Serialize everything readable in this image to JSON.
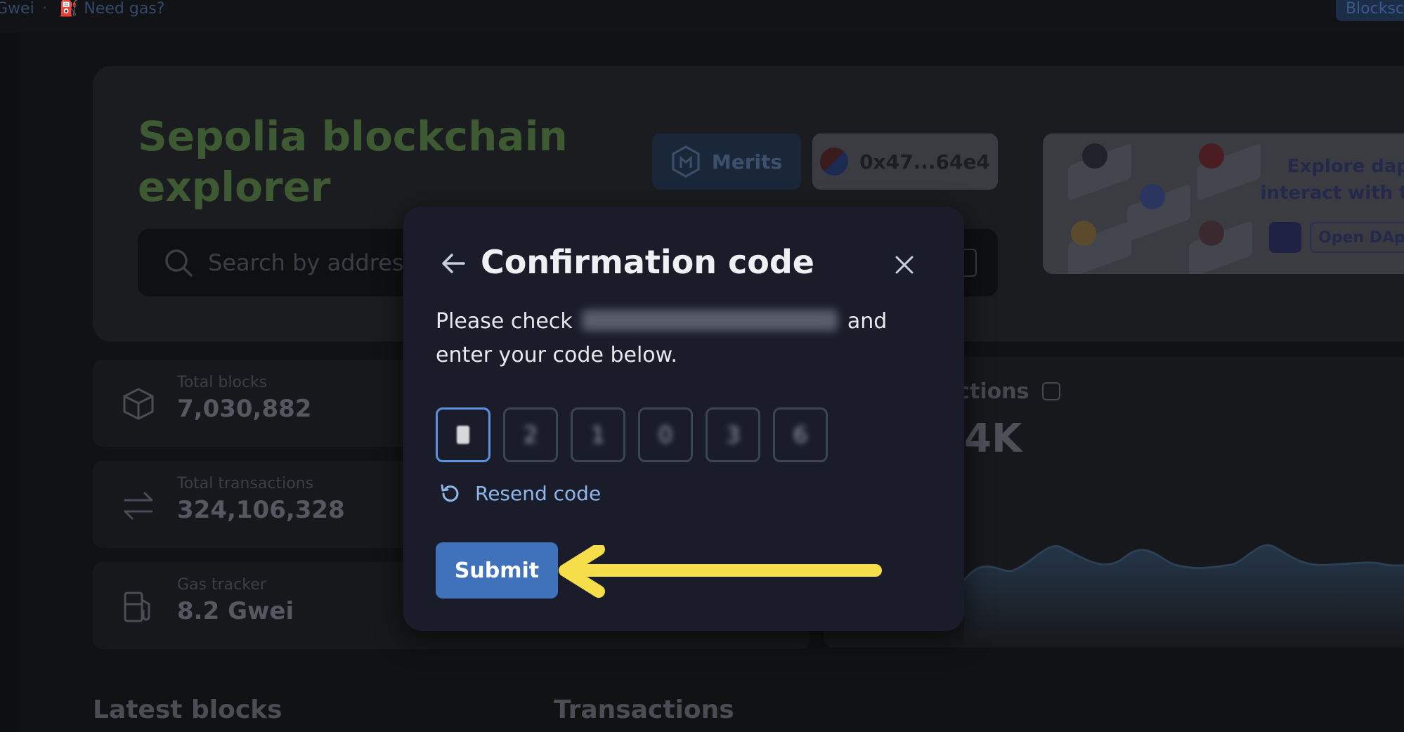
{
  "topbar": {
    "gas_unit": "Gwei",
    "separator": "·",
    "need_gas_label": "Need gas?",
    "blockscout_label": "Blocksc"
  },
  "hero": {
    "title": "Sepolia blockchain explorer",
    "search_placeholder": "Search by address",
    "merits_label": "Merits",
    "wallet_address": "0x47...64e4",
    "ad_text": "Explore dapps interact with tho",
    "ad_button": "Open DApp"
  },
  "stats": [
    {
      "label": "Total blocks",
      "value": "7,030,882",
      "icon": "cube-icon"
    },
    {
      "label": "Total transactions",
      "value": "324,106,328",
      "icon": "arrows-exchange-icon"
    },
    {
      "label": "Gas tracker",
      "value": "8.2 Gwei",
      "icon": "gas-pump-icon"
    }
  ],
  "tx_panel": {
    "label": "actions",
    "value": "4K"
  },
  "sections": {
    "latest_blocks": "Latest blocks",
    "transactions": "Transactions"
  },
  "modal": {
    "title": "Confirmation code",
    "instruction_prefix": "Please check",
    "instruction_suffix": "and enter your code below.",
    "code_digits": [
      "",
      "2",
      "1",
      "0",
      "3",
      "6"
    ],
    "resend_label": "Resend code",
    "submit_label": "Submit"
  },
  "colors": {
    "accent": "#3f72bb",
    "link": "#8fb6ea",
    "annotation_arrow": "#f5de4a",
    "modal_bg": "#1a1d29"
  }
}
